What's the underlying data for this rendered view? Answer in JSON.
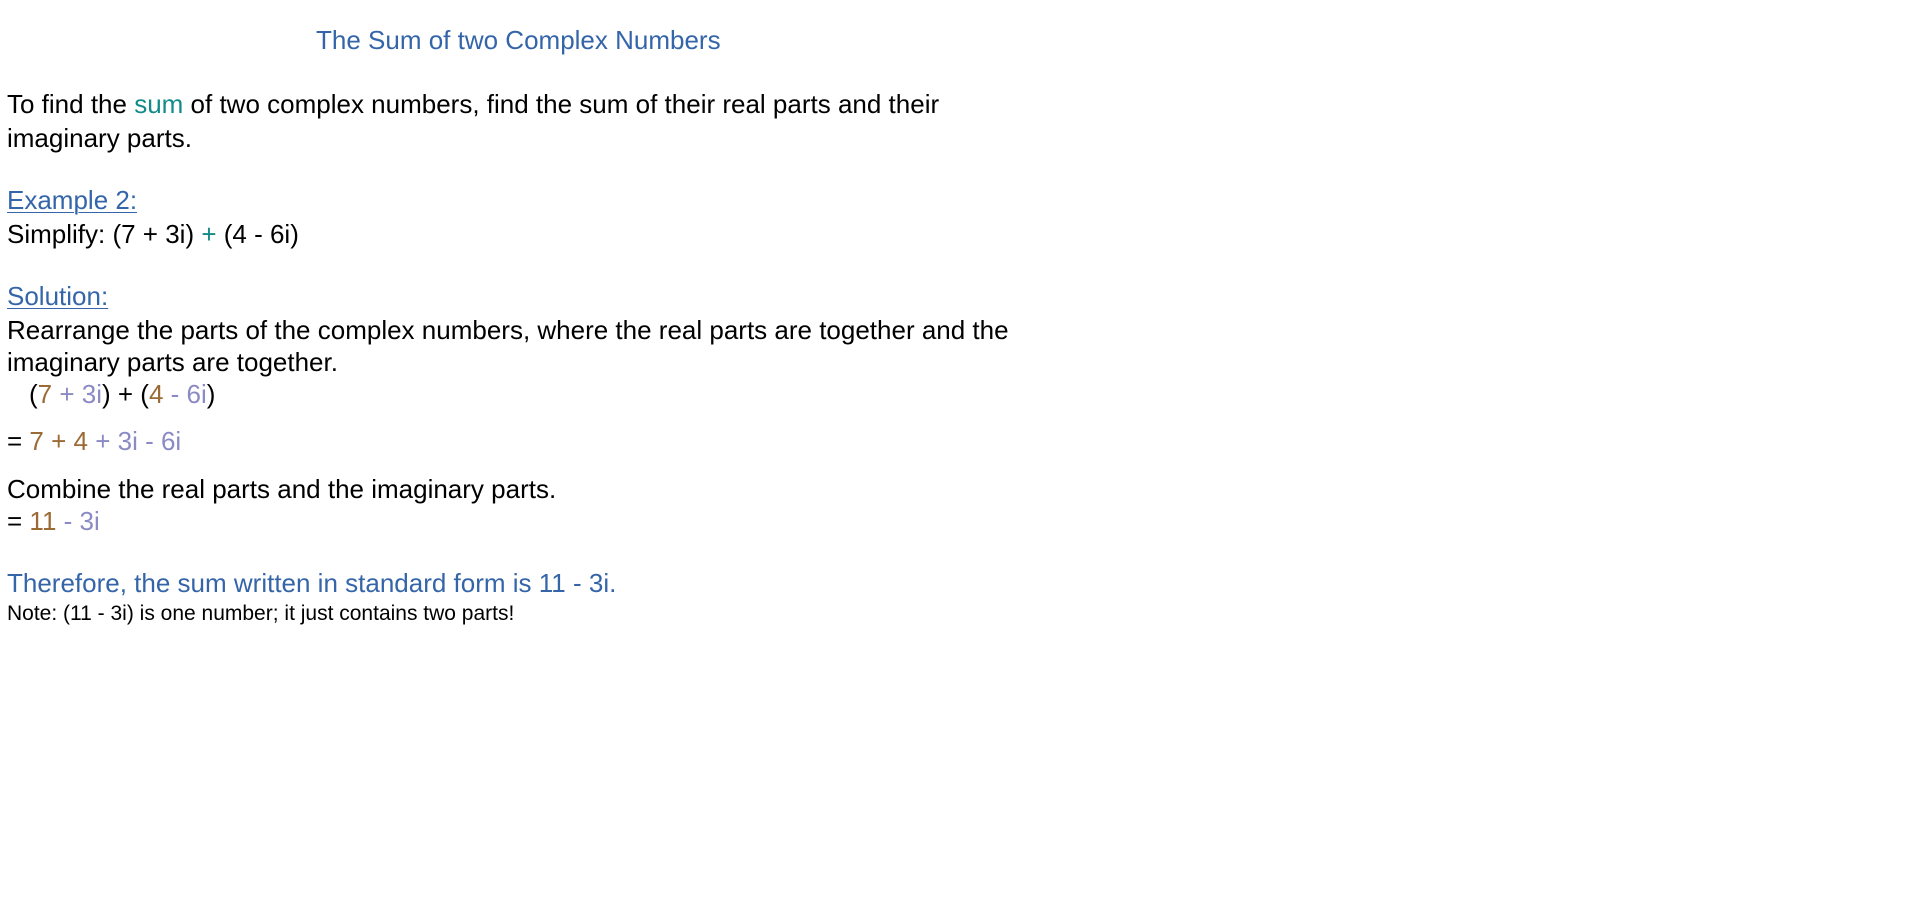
{
  "title": "The Sum of two Complex Numbers",
  "intro": {
    "line1_a": "To find the ",
    "line1_sum": "sum",
    "line1_b": " of two complex numbers, find the sum of their real parts and their",
    "line2": "imaginary parts."
  },
  "example": {
    "heading": "Example 2:",
    "prefix": "Simplify:  (7 + 3i) ",
    "plus": "+",
    "suffix": " (4 - 6i)"
  },
  "solution": {
    "heading": "Solution:",
    "line1": "Rearrange the parts of the complex numbers, where the real parts are together and the",
    "line2": "imaginary parts are together.",
    "expr1": {
      "open1": "(",
      "real1": "7",
      "imag1": " + 3i",
      "mid": ") + (",
      "real2": "4",
      "imag2": " - 6i",
      "close": ")"
    },
    "expr2": {
      "eq": "= ",
      "reals": "7 + 4",
      "imags": " + 3i - 6i"
    },
    "combine": "Combine the real parts and the imaginary parts.",
    "expr3": {
      "eq": "= ",
      "real": "11",
      "imag": " - 3i"
    },
    "conclusion": "Therefore, the sum written in standard form is 11 - 3i.",
    "note": "Note:  (11 - 3i) is one number; it just contains two parts!"
  },
  "colors": {
    "blue": "#3565a9",
    "teal": "#138a8a",
    "brown": "#9c6a34",
    "lavender": "#8a8ac4"
  }
}
